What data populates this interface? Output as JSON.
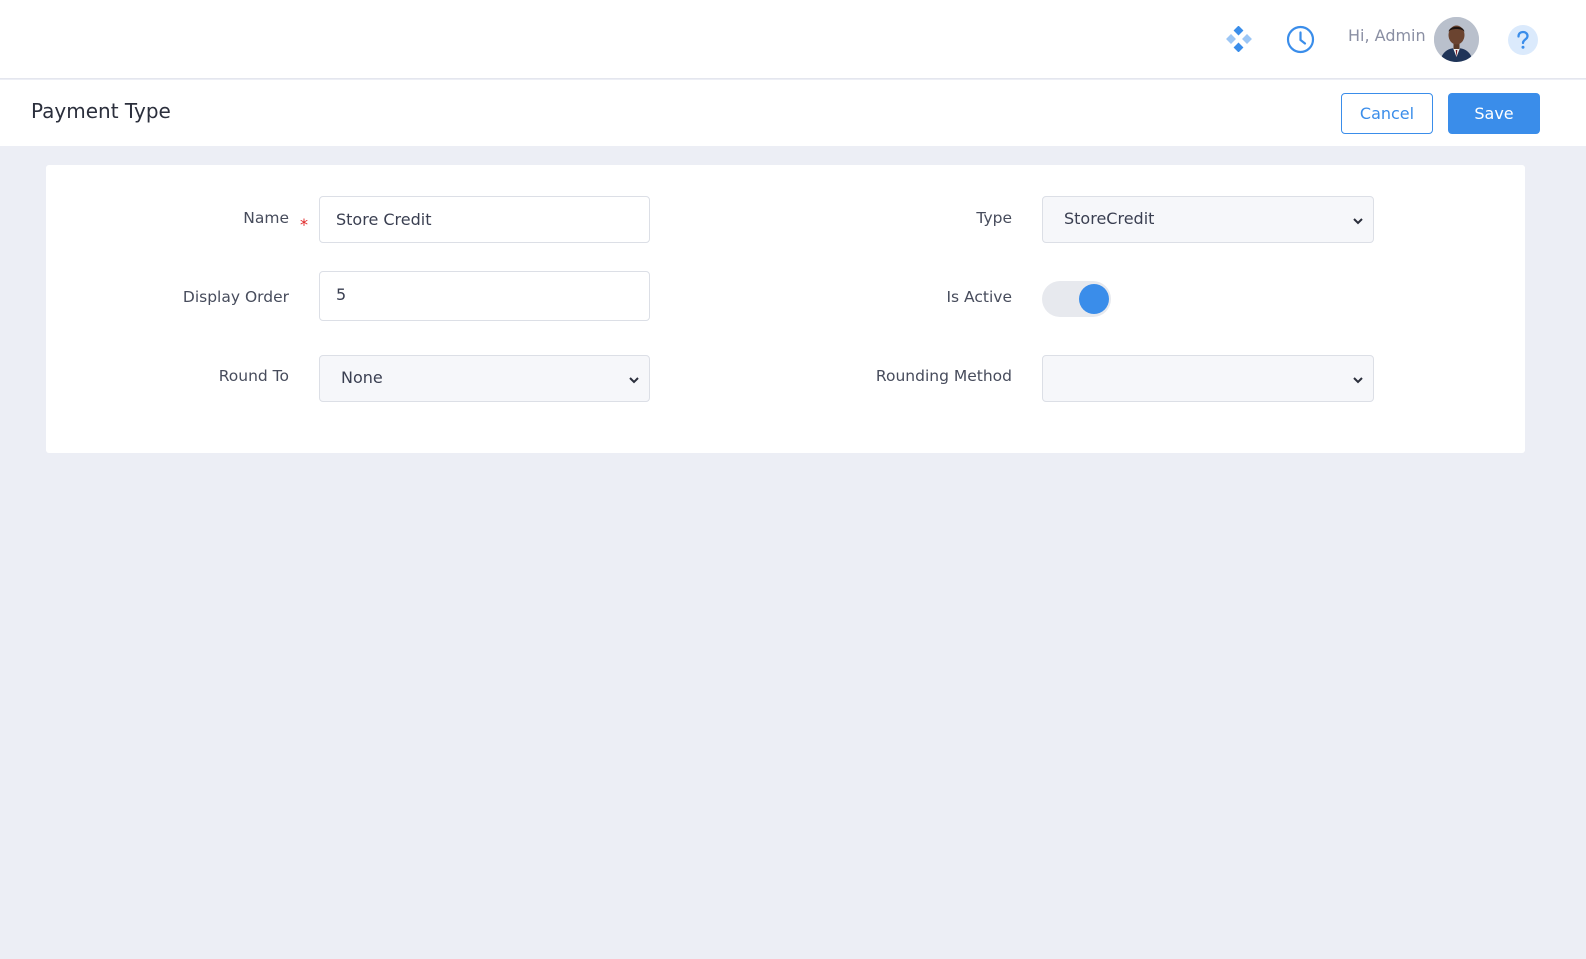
{
  "topbar": {
    "greeting": "Hi, Admin",
    "icons": [
      "apps-icon",
      "clock-icon",
      "avatar",
      "help-icon"
    ]
  },
  "page": {
    "title": "Payment Type",
    "cancel_label": "Cancel",
    "save_label": "Save"
  },
  "form": {
    "name": {
      "label": "Name",
      "required_mark": "*",
      "value": "Store Credit"
    },
    "type": {
      "label": "Type",
      "value": "StoreCredit"
    },
    "display_order": {
      "label": "Display Order",
      "value": "5"
    },
    "is_active": {
      "label": "Is Active",
      "checked": true
    },
    "round_to": {
      "label": "Round To",
      "value": "None"
    },
    "rounding_method": {
      "label": "Rounding Method",
      "value": ""
    }
  },
  "colors": {
    "accent": "#3a8dea",
    "background": "#eceef5",
    "required": "#e02424"
  }
}
